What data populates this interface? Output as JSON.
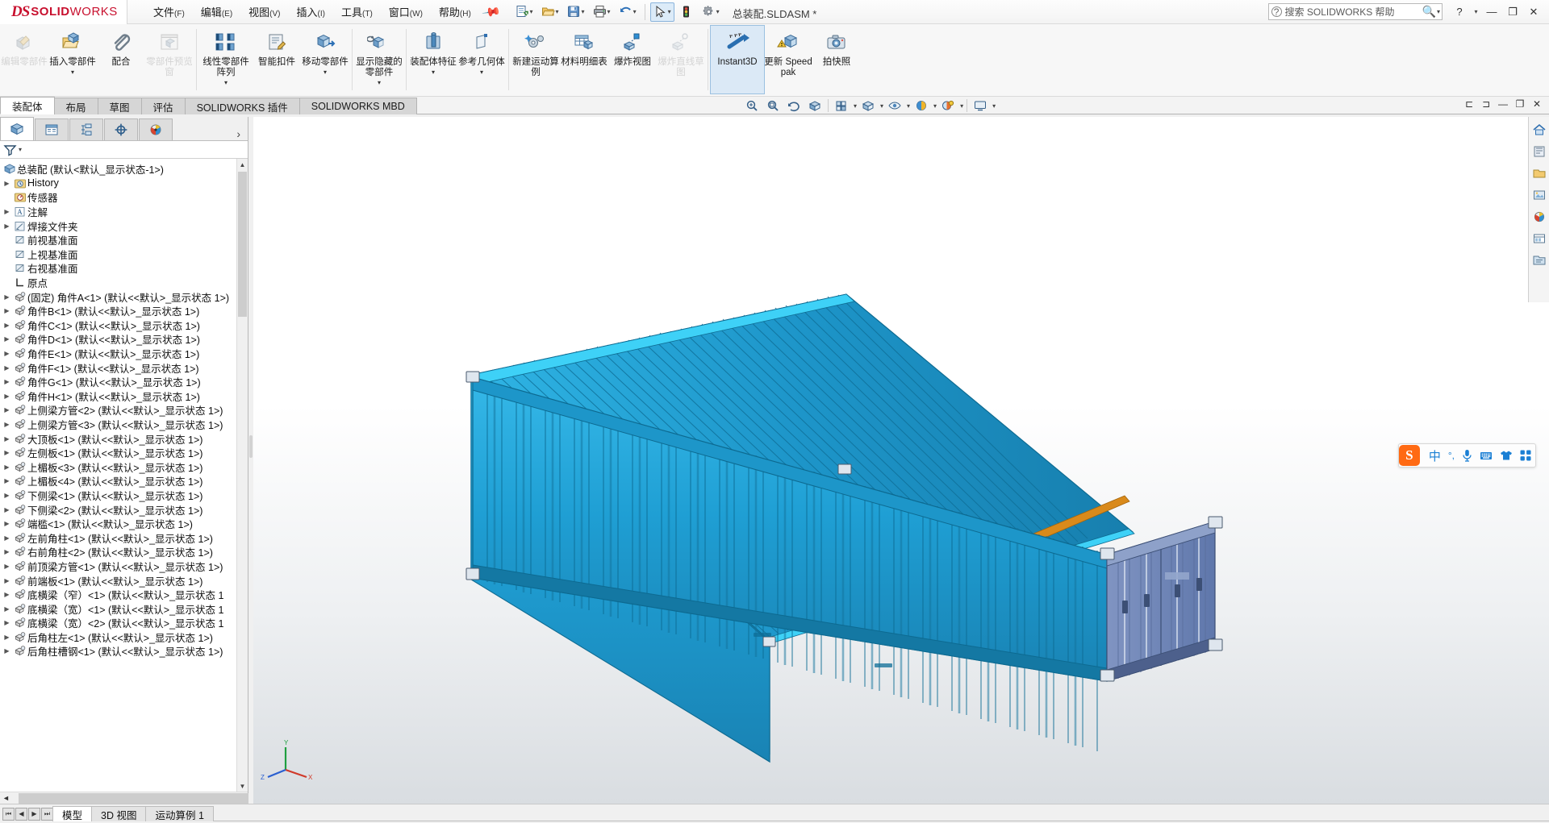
{
  "app": {
    "brand_ds": "DS",
    "brand_solid": "SOLID",
    "brand_works": "WORKS",
    "document_title": "总装配.SLDASM *"
  },
  "menu": [
    {
      "label": "文件",
      "mnemonic": "(F)"
    },
    {
      "label": "编辑",
      "mnemonic": "(E)"
    },
    {
      "label": "视图",
      "mnemonic": "(V)"
    },
    {
      "label": "插入",
      "mnemonic": "(I)"
    },
    {
      "label": "工具",
      "mnemonic": "(T)"
    },
    {
      "label": "窗口",
      "mnemonic": "(W)"
    },
    {
      "label": "帮助",
      "mnemonic": "(H)"
    }
  ],
  "quick_access": [
    {
      "name": "new-document",
      "icon": "new-doc-icon",
      "dropdown": true
    },
    {
      "name": "open-document",
      "icon": "open-folder-icon",
      "dropdown": true
    },
    {
      "name": "save-document",
      "icon": "save-disk-icon",
      "dropdown": true
    },
    {
      "name": "print-document",
      "icon": "printer-icon",
      "dropdown": true
    },
    {
      "name": "undo",
      "icon": "undo-arrow-icon",
      "dropdown": true
    },
    {
      "name": "select-tool",
      "icon": "cursor-arrow-icon",
      "dropdown": true,
      "selected": true
    },
    {
      "name": "rebuild",
      "icon": "traffic-light-icon",
      "dropdown": false
    },
    {
      "name": "options",
      "icon": "gear-icon",
      "dropdown": true
    }
  ],
  "help_search": {
    "placeholder": "搜索 SOLIDWORKS 帮助",
    "question_icon": "question-mark-icon",
    "magnifier_icon": "search-icon"
  },
  "window_controls": {
    "help": "?",
    "minimize": "—",
    "restore": "❐",
    "close": "✕"
  },
  "ribbon": {
    "buttons": [
      {
        "label": "编辑零部件",
        "icon": "edit-component-icon",
        "disabled": true,
        "dropdown": false
      },
      {
        "label": "插入零部件",
        "icon": "insert-component-icon",
        "disabled": false,
        "dropdown": true
      },
      {
        "label": "配合",
        "icon": "mate-paperclip-icon",
        "disabled": false,
        "dropdown": false
      },
      {
        "label": "零部件预览窗",
        "icon": "component-preview-icon",
        "disabled": true,
        "dropdown": false
      },
      {
        "label": "线性零部件阵列",
        "icon": "linear-pattern-icon",
        "disabled": false,
        "dropdown": true
      },
      {
        "label": "智能扣件",
        "icon": "smart-fastener-icon",
        "disabled": false,
        "dropdown": false
      },
      {
        "label": "移动零部件",
        "icon": "move-component-icon",
        "disabled": false,
        "dropdown": true
      },
      {
        "label": "显示隐藏的零部件",
        "icon": "show-hidden-components-icon",
        "disabled": false,
        "dropdown": true
      },
      {
        "label": "装配体特征",
        "icon": "assembly-feature-icon",
        "disabled": false,
        "dropdown": true
      },
      {
        "label": "参考几何体",
        "icon": "reference-geometry-icon",
        "disabled": false,
        "dropdown": true
      },
      {
        "label": "新建运动算例",
        "icon": "new-motion-study-icon",
        "disabled": false,
        "dropdown": false
      },
      {
        "label": "材料明细表",
        "icon": "bom-table-icon",
        "disabled": false,
        "dropdown": false
      },
      {
        "label": "爆炸视图",
        "icon": "exploded-view-icon",
        "disabled": false,
        "dropdown": false
      },
      {
        "label": "爆炸直线草图",
        "icon": "explode-line-sketch-icon",
        "disabled": true,
        "dropdown": false
      },
      {
        "label": "Instant3D",
        "icon": "instant3d-icon",
        "disabled": false,
        "dropdown": false,
        "active": true
      },
      {
        "label": "更新 Speedpak",
        "icon": "update-speedpak-icon",
        "disabled": false,
        "dropdown": false
      },
      {
        "label": "拍快照",
        "icon": "snapshot-camera-icon",
        "disabled": false,
        "dropdown": false
      }
    ],
    "separators_after": [
      3,
      7,
      9,
      13,
      14
    ]
  },
  "ribbon_tabs": [
    {
      "label": "装配体",
      "active": true
    },
    {
      "label": "布局",
      "active": false
    },
    {
      "label": "草图",
      "active": false
    },
    {
      "label": "评估",
      "active": false
    },
    {
      "label": "SOLIDWORKS 插件",
      "active": false
    },
    {
      "label": "SOLIDWORKS MBD",
      "active": false
    }
  ],
  "view_toolbar": [
    {
      "name": "zoom-to-fit-icon",
      "dropdown": false
    },
    {
      "name": "zoom-to-area-icon",
      "dropdown": false
    },
    {
      "name": "previous-view-icon",
      "dropdown": false
    },
    {
      "name": "section-view-icon",
      "dropdown": false
    },
    {
      "name": "view-orientation-icon",
      "dropdown": true
    },
    {
      "name": "display-style-icon",
      "dropdown": true
    },
    {
      "name": "hide-show-items-icon",
      "dropdown": true
    },
    {
      "name": "edit-appearance-icon",
      "dropdown": true
    },
    {
      "name": "apply-scene-icon",
      "dropdown": true
    },
    {
      "name": "view-settings-icon",
      "dropdown": true
    }
  ],
  "doc_window_controls": [
    "⊏",
    "⊐",
    "—",
    "❐",
    "✕"
  ],
  "feature_manager": {
    "tabs": [
      {
        "name": "feature-manager-tree-tab",
        "icon": "assembly-cube-icon",
        "active": true
      },
      {
        "name": "property-manager-tab",
        "icon": "property-list-icon",
        "active": false
      },
      {
        "name": "configuration-manager-tab",
        "icon": "configuration-icon",
        "active": false
      },
      {
        "name": "dimxpert-manager-tab",
        "icon": "dimxpert-target-icon",
        "active": false
      },
      {
        "name": "display-manager-tab",
        "icon": "display-palette-icon",
        "active": false
      }
    ],
    "expand_arrow": "›",
    "filter_icon": "filter-funnel-icon",
    "tree": [
      {
        "label": "总装配  (默认<默认_显示状态-1>)",
        "icon": "assembly-cube-icon",
        "arrow": false,
        "root": true
      },
      {
        "label": "History",
        "icon": "history-clock-icon",
        "arrow": true
      },
      {
        "label": "传感器",
        "icon": "sensor-icon",
        "arrow": false
      },
      {
        "label": "注解",
        "icon": "annotation-a-icon",
        "arrow": true
      },
      {
        "label": "焊接文件夹",
        "icon": "weld-folder-icon",
        "arrow": true
      },
      {
        "label": "前视基准面",
        "icon": "plane-icon",
        "arrow": false
      },
      {
        "label": "上视基准面",
        "icon": "plane-icon",
        "arrow": false
      },
      {
        "label": "右视基准面",
        "icon": "plane-icon",
        "arrow": false
      },
      {
        "label": "原点",
        "icon": "origin-icon",
        "arrow": false
      },
      {
        "label": "(固定) 角件A<1>  (默认<<默认>_显示状态 1>)",
        "icon": "part-icon",
        "arrow": true
      },
      {
        "label": "角件B<1>  (默认<<默认>_显示状态 1>)",
        "icon": "part-icon",
        "arrow": true
      },
      {
        "label": "角件C<1>  (默认<<默认>_显示状态 1>)",
        "icon": "part-icon",
        "arrow": true
      },
      {
        "label": "角件D<1>  (默认<<默认>_显示状态 1>)",
        "icon": "part-icon",
        "arrow": true
      },
      {
        "label": "角件E<1>  (默认<<默认>_显示状态 1>)",
        "icon": "part-icon",
        "arrow": true
      },
      {
        "label": "角件F<1>  (默认<<默认>_显示状态 1>)",
        "icon": "part-icon",
        "arrow": true
      },
      {
        "label": "角件G<1>  (默认<<默认>_显示状态 1>)",
        "icon": "part-icon",
        "arrow": true
      },
      {
        "label": "角件H<1>  (默认<<默认>_显示状态 1>)",
        "icon": "part-icon",
        "arrow": true
      },
      {
        "label": "上侧梁方管<2>  (默认<<默认>_显示状态 1>)",
        "icon": "part-icon",
        "arrow": true
      },
      {
        "label": "上侧梁方管<3>  (默认<<默认>_显示状态 1>)",
        "icon": "part-icon",
        "arrow": true
      },
      {
        "label": "大顶板<1>  (默认<<默认>_显示状态 1>)",
        "icon": "part-icon",
        "arrow": true
      },
      {
        "label": "左侧板<1>  (默认<<默认>_显示状态 1>)",
        "icon": "part-icon",
        "arrow": true
      },
      {
        "label": "上楣板<3>  (默认<<默认>_显示状态 1>)",
        "icon": "part-icon",
        "arrow": true
      },
      {
        "label": "上楣板<4>  (默认<<默认>_显示状态 1>)",
        "icon": "part-icon",
        "arrow": true
      },
      {
        "label": "下侧梁<1>  (默认<<默认>_显示状态 1>)",
        "icon": "part-icon",
        "arrow": true
      },
      {
        "label": "下侧梁<2>  (默认<<默认>_显示状态 1>)",
        "icon": "part-icon",
        "arrow": true
      },
      {
        "label": "端槛<1>  (默认<<默认>_显示状态 1>)",
        "icon": "part-icon",
        "arrow": true
      },
      {
        "label": "左前角柱<1>  (默认<<默认>_显示状态 1>)",
        "icon": "part-icon",
        "arrow": true
      },
      {
        "label": "右前角柱<2>  (默认<<默认>_显示状态 1>)",
        "icon": "part-icon",
        "arrow": true
      },
      {
        "label": "前顶梁方管<1>  (默认<<默认>_显示状态 1>)",
        "icon": "part-icon",
        "arrow": true
      },
      {
        "label": "前端板<1>  (默认<<默认>_显示状态 1>)",
        "icon": "part-icon",
        "arrow": true
      },
      {
        "label": "底横梁（窄）<1>  (默认<<默认>_显示状态 1",
        "icon": "part-icon",
        "arrow": true
      },
      {
        "label": "底横梁（宽）<1>  (默认<<默认>_显示状态 1",
        "icon": "part-icon",
        "arrow": true
      },
      {
        "label": "底横梁（宽）<2>  (默认<<默认>_显示状态 1",
        "icon": "part-icon",
        "arrow": true
      },
      {
        "label": "后角柱左<1>  (默认<<默认>_显示状态 1>)",
        "icon": "part-icon",
        "arrow": true
      },
      {
        "label": "后角柱槽钢<1>  (默认<<默认>_显示状态 1>)",
        "icon": "part-icon",
        "arrow": true
      }
    ]
  },
  "right_dock": [
    {
      "name": "view-home-icon"
    },
    {
      "name": "appearances-icon"
    },
    {
      "name": "scenes-folder-icon"
    },
    {
      "name": "decals-icon"
    },
    {
      "name": "custom-appearance-icon"
    },
    {
      "name": "design-library-icon"
    },
    {
      "name": "file-explorer-icon"
    }
  ],
  "ime": {
    "logo": "S",
    "mode": "中",
    "punctuation": "°,",
    "icons": [
      "microphone-icon",
      "keyboard-icon",
      "skin-shirt-icon",
      "toolbox-grid-icon"
    ]
  },
  "status_bar": {
    "nav": [
      "⏮",
      "◀",
      "▶",
      "⏭"
    ],
    "tabs": [
      {
        "label": "模型",
        "active": true
      },
      {
        "label": "3D 视图",
        "active": false
      },
      {
        "label": "运动算例 1",
        "active": false
      }
    ]
  },
  "model": {
    "description": "40英尺集装箱装配体等轴测视图",
    "colors": {
      "body": "#1f9fd4",
      "body_dark": "#1a7fae",
      "roof": "#2aa8dc",
      "door": "#6e86b8",
      "accent_orange": "#d98a1b",
      "accent_cyan": "#2fc2f0"
    }
  }
}
